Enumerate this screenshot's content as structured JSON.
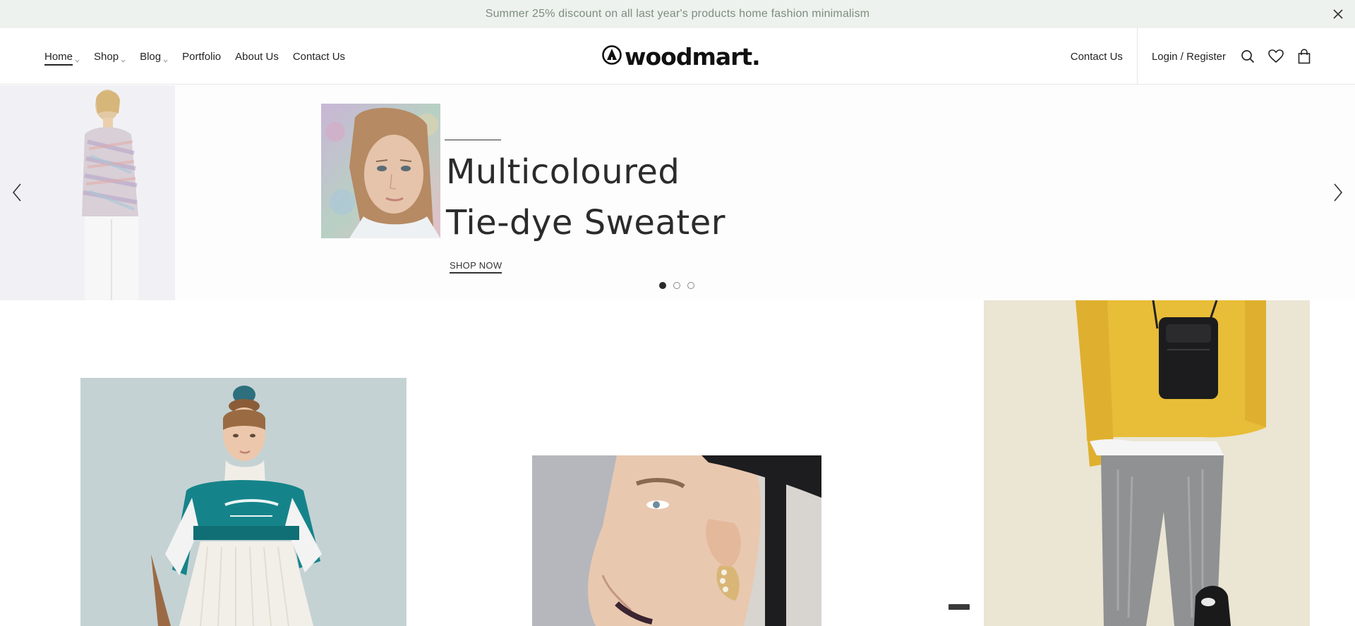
{
  "promo": {
    "text": "Summer 25% discount on all last year's products home fashion minimalism",
    "close_icon": "close-icon"
  },
  "nav": {
    "items": [
      {
        "label": "Home",
        "has_dropdown": true,
        "active": true
      },
      {
        "label": "Shop",
        "has_dropdown": true,
        "active": false
      },
      {
        "label": "Blog",
        "has_dropdown": true,
        "active": false
      },
      {
        "label": "Portfolio",
        "has_dropdown": false,
        "active": false
      },
      {
        "label": "About Us",
        "has_dropdown": false,
        "active": false
      },
      {
        "label": "Contact Us",
        "has_dropdown": false,
        "active": false
      }
    ]
  },
  "logo": {
    "text": "woodmart."
  },
  "header_right": {
    "contact_label": "Contact Us",
    "login_label": "Login / Register",
    "icons": [
      "search-icon",
      "heart-icon",
      "bag-icon"
    ]
  },
  "hero": {
    "title_line1": "Multicoloured",
    "title_line2": "Tie-dye Sweater",
    "button_label": "SHOP NOW",
    "slide_count": 3,
    "active_slide": 1
  },
  "colors": {
    "promo_bg": "#eef2ee",
    "promo_text": "#7d8d7e",
    "text": "#242424",
    "banner1_bg": "#c3d1d3",
    "banner2_bg": "#b6b7bd",
    "banner3_bg": "#ebe5d4"
  }
}
